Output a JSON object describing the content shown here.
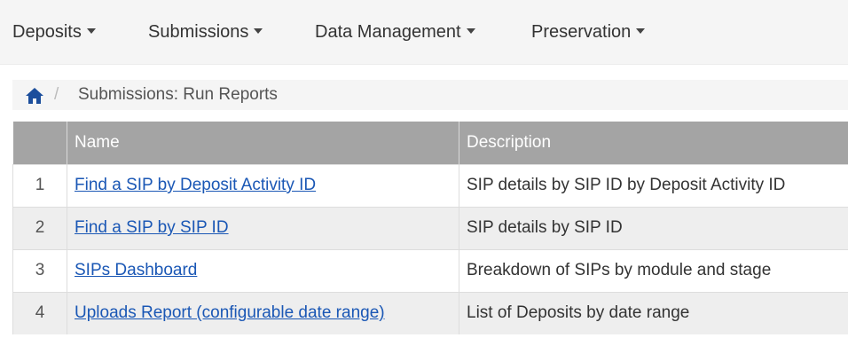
{
  "nav": {
    "items": [
      {
        "label": "Deposits"
      },
      {
        "label": "Submissions"
      },
      {
        "label": "Data Management"
      },
      {
        "label": "Preservation"
      }
    ]
  },
  "breadcrumb": {
    "home_icon": "home-icon",
    "separator": "/",
    "current": "Submissions: Run Reports"
  },
  "table": {
    "headers": {
      "index": "",
      "name": "Name",
      "description": "Description"
    },
    "rows": [
      {
        "index": "1",
        "name": "Find a SIP by Deposit Activity ID",
        "description": "SIP details by SIP ID by Deposit Activity ID"
      },
      {
        "index": "2",
        "name": "Find a SIP by SIP ID",
        "description": "SIP details by SIP ID"
      },
      {
        "index": "3",
        "name": "SIPs Dashboard",
        "description": "Breakdown of SIPs by module and stage"
      },
      {
        "index": "4",
        "name": "Uploads Report (configurable date range)",
        "description": "List of Deposits by date range"
      }
    ]
  },
  "colors": {
    "link": "#1a57b5",
    "header_bg": "#a4a4a4",
    "nav_bg": "#f5f5f5",
    "home_icon": "#1c4e9c"
  }
}
